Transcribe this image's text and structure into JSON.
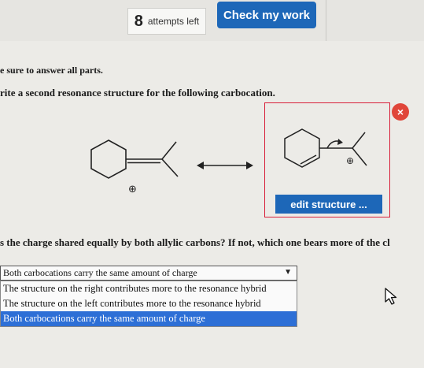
{
  "header": {
    "attempts_count": "8",
    "attempts_label": "attempts left",
    "check_button": "Check my work"
  },
  "instructions": {
    "line1": "e sure to answer all parts.",
    "line2": "rite a second resonance structure for the following carbocation."
  },
  "structures": {
    "charge_symbol": "⊕",
    "resonance_arrow": "↔"
  },
  "answer_box": {
    "close_label": "×",
    "edit_button": "edit structure ..."
  },
  "question": {
    "text": "s the charge shared equally by both allylic carbons? If not, which one bears more of the cl"
  },
  "dropdown": {
    "selected": "Both carbocations carry the same amount of charge",
    "options": [
      "The structure on the right contributes more to the resonance hybrid",
      "The structure on the left contributes more to the resonance hybrid",
      "Both carbocations carry the same amount of charge"
    ],
    "highlighted_index": 2
  },
  "colors": {
    "accent": "#1d67b8",
    "error_border": "#d8203a",
    "highlight": "#2d6fd6"
  }
}
